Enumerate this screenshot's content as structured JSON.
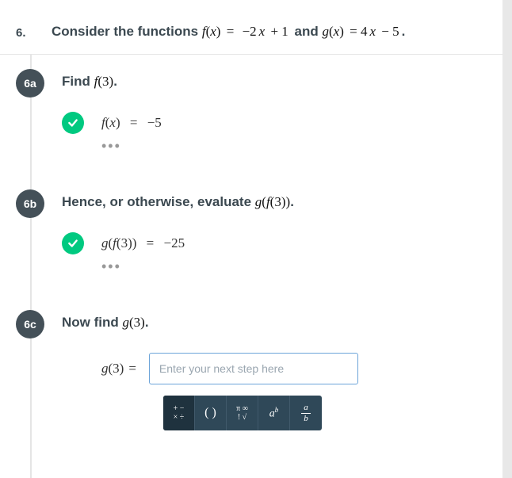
{
  "question": {
    "number": "6.",
    "prompt_before": "Consider the functions ",
    "func_f": "f(x) = −2x + 1",
    "joiner": " and ",
    "func_g": "g(x) = 4x − 5",
    "tail": "."
  },
  "parts": {
    "a": {
      "badge": "6a",
      "prompt_before": "Find ",
      "prompt_math": "f(3)",
      "prompt_after": ".",
      "answer_lhs": "f(x)",
      "answer_rhs": "−5"
    },
    "b": {
      "badge": "6b",
      "prompt_before": "Hence, or otherwise, evaluate ",
      "prompt_math": "g(f(3))",
      "prompt_after": ".",
      "answer_lhs": "g(f(3))",
      "answer_rhs": "−25"
    },
    "c": {
      "badge": "6c",
      "prompt_before": "Now find ",
      "prompt_math": "g(3)",
      "prompt_after": ".",
      "input_prefix": "g(3)",
      "input_placeholder": "Enter your next step here"
    }
  },
  "toolbar": {
    "ops": "+−\n×÷",
    "paren": "( )",
    "radicals": "π ∞\n! √",
    "exp": "a",
    "exp_sup": "b",
    "frac_num": "a",
    "frac_den": "b"
  },
  "dots": "•••"
}
